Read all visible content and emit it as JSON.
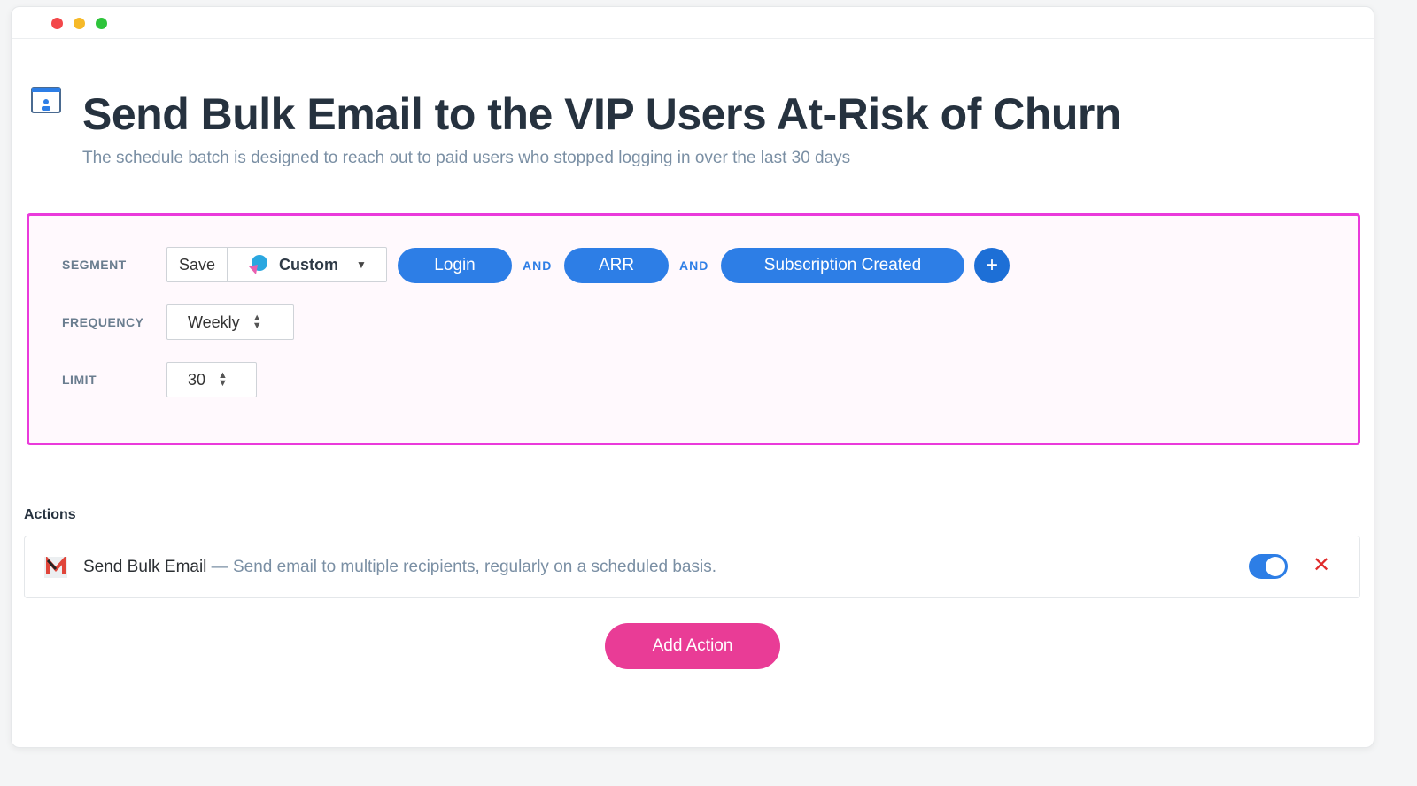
{
  "header": {
    "title": "Send Bulk Email to the VIP Users At-Risk of Churn",
    "subtitle": "The schedule batch is designed to reach out to paid users who stopped logging in over the last 30 days"
  },
  "segment": {
    "label": "SEGMENT",
    "save_label": "Save",
    "selected": "Custom",
    "conditions": [
      "Login",
      "ARR",
      "Subscription Created"
    ],
    "joiner": "AND"
  },
  "frequency": {
    "label": "FREQUENCY",
    "value": "Weekly"
  },
  "limit": {
    "label": "LIMIT",
    "value": "30"
  },
  "actions": {
    "heading": "Actions",
    "items": [
      {
        "name": "Send Bulk Email",
        "separator": " — ",
        "description": "Send email to multiple recipients, regularly on a scheduled basis.",
        "enabled": true
      }
    ],
    "add_label": "Add Action"
  },
  "colors": {
    "accent": "#2d7ee6",
    "highlight_border": "#ea3adb",
    "add_button": "#e93c96"
  }
}
